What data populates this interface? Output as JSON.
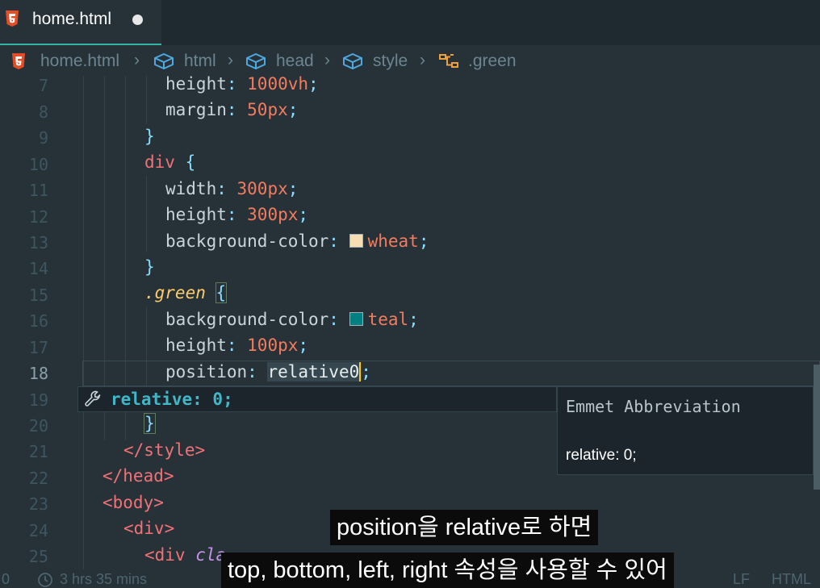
{
  "tab": {
    "filename": "home.html"
  },
  "breadcrumb": {
    "items": [
      "home.html",
      "html",
      "head",
      "style",
      ".green"
    ]
  },
  "lines": [
    {
      "num": "7"
    },
    {
      "num": "8"
    },
    {
      "num": "9"
    },
    {
      "num": "10"
    },
    {
      "num": "11"
    },
    {
      "num": "12"
    },
    {
      "num": "13"
    },
    {
      "num": "14"
    },
    {
      "num": "15"
    },
    {
      "num": "16"
    },
    {
      "num": "17"
    },
    {
      "num": "18"
    },
    {
      "num": "19"
    },
    {
      "num": "20"
    },
    {
      "num": "21"
    },
    {
      "num": "22"
    },
    {
      "num": "23"
    },
    {
      "num": "24"
    },
    {
      "num": "25"
    }
  ],
  "code": {
    "l7_prop": "height",
    "l7_val": "1000vh",
    "l8_prop": "margin",
    "l8_val": "50px",
    "l9": "}",
    "l10_sel": "div",
    "l10_brace": "{",
    "l11_prop": "width",
    "l11_val": "300px",
    "l12_prop": "height",
    "l12_val": "300px",
    "l13_prop": "background-color",
    "l13_val": "wheat",
    "l14": "}",
    "l15_sel": ".green",
    "l15_brace": "{",
    "l16_prop": "background-color",
    "l16_val": "teal",
    "l17_prop": "height",
    "l17_val": "100px",
    "l18_prop": "position",
    "l18_val": "relative0",
    "l20": "}",
    "l21": "</style>",
    "l22": "</head>",
    "l23": "<body>",
    "l24": "<div>",
    "l25_open": "<div",
    "l25_attr": "cla"
  },
  "swatch_colors": {
    "wheat": "#f5deb3",
    "teal": "#008080"
  },
  "suggestion": {
    "icon": "wrench-icon",
    "label": "relative: 0;"
  },
  "detail": {
    "title": "Emmet Abbreviation",
    "body": "relative: 0;"
  },
  "status": {
    "left": "0",
    "time": "3 hrs 35 mins",
    "eol": "LF",
    "lang": "HTML"
  },
  "subtitles": {
    "line1": "position을 relative로 하면",
    "line2": "top, bottom, left, right 속성을 사용할 수 있어"
  }
}
